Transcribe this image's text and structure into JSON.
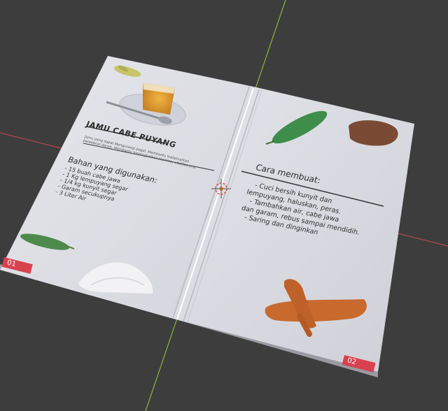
{
  "left_page": {
    "title": "JAMU CABE PUYANG",
    "subtitle_line1": "Jamu yang dapat Mengurangi pegal, Membantu melancarkan",
    "subtitle_line2": "peredaran darah, Membantu meningkatkan stamina, vitalitas pria",
    "ingredients_heading": "Bahan yang digunakan:",
    "ingredients": [
      "- 15 buah cabe jawa",
      "- 1 Kg lempuyang segar",
      "- 1/4 kg kunyit segar",
      "- Garam secukupnya",
      "- 3 Liter Air"
    ],
    "page_number": "01"
  },
  "right_page": {
    "heading": "Cara membuat:",
    "steps": [
      "- Cuci bersih kunyit dan",
      "lempuyang, haluskan, peras.",
      "- Tambahkan air, cabe jawa",
      "dan garam, rebus sampai mendidih.",
      "- Saring dan dinginkan"
    ],
    "page_number": "02"
  },
  "colors": {
    "background": "#3d3d3d",
    "grid_x_axis": "#b04652",
    "grid_y_axis": "#8cb23c",
    "page": "#dfe0e6",
    "accent": "#d8424f"
  },
  "icons": {
    "origin": "3d-cursor-icon"
  }
}
